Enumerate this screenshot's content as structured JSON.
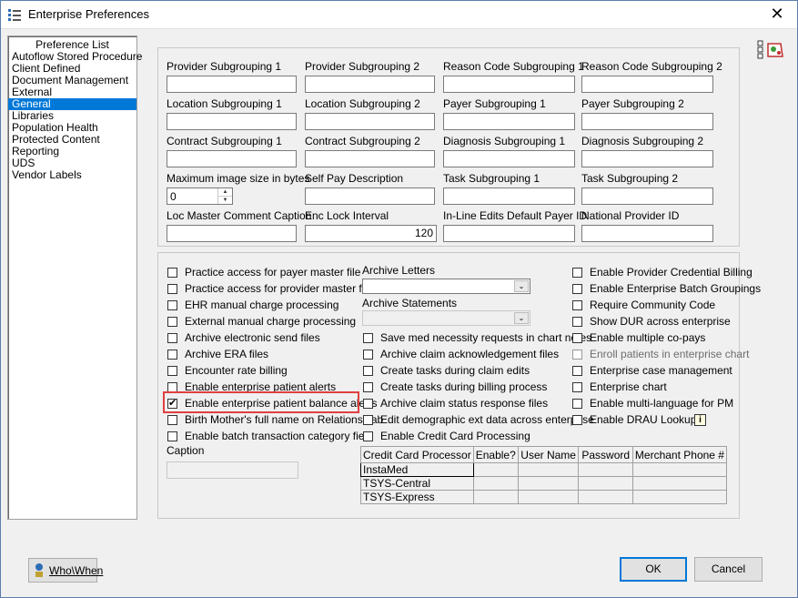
{
  "window": {
    "title": "Enterprise Preferences",
    "close_glyph": "✕"
  },
  "preference_list": {
    "header": "Preference List",
    "items": [
      "Autoflow Stored Procedure",
      "Client Defined",
      "Document Management",
      "External",
      "General",
      "Libraries",
      "Population Health",
      "Protected Content",
      "Reporting",
      "UDS",
      "Vendor Labels"
    ],
    "selected": "General"
  },
  "fields": {
    "provider_subgrouping_1": "Provider Subgrouping 1",
    "provider_subgrouping_2": "Provider Subgrouping 2",
    "reason_code_subgrouping_1": "Reason Code Subgrouping 1",
    "reason_code_subgrouping_2": "Reason Code Subgrouping 2",
    "location_subgrouping_1": "Location Subgrouping 1",
    "location_subgrouping_2": "Location Subgrouping 2",
    "payer_subgrouping_1": "Payer Subgrouping 1",
    "payer_subgrouping_2": "Payer Subgrouping 2",
    "contract_subgrouping_1": "Contract Subgrouping 1",
    "contract_subgrouping_2": "Contract Subgrouping 2",
    "diagnosis_subgrouping_1": "Diagnosis Subgrouping 1",
    "diagnosis_subgrouping_2": "Diagnosis Subgrouping 2",
    "max_image_size": "Maximum image size in bytes",
    "max_image_size_value": "0",
    "self_pay_description": "Self Pay Description",
    "task_subgrouping_1": "Task Subgrouping 1",
    "task_subgrouping_2": "Task Subgrouping 2",
    "loc_master_comment_caption": "Loc Master Comment Caption",
    "enc_lock_interval": "Enc Lock Interval",
    "enc_lock_interval_value": "120",
    "inline_edits_default_payer_id": "In-Line Edits Default Payer ID",
    "national_provider_id": "National Provider ID"
  },
  "checkboxes_col1": [
    {
      "label": "Practice access for payer master file",
      "checked": false
    },
    {
      "label": "Practice access for provider master file",
      "checked": false
    },
    {
      "label": "EHR manual charge processing",
      "checked": false
    },
    {
      "label": "External manual charge processing",
      "checked": false
    },
    {
      "label": "Archive electronic send files",
      "checked": false
    },
    {
      "label": "Archive ERA files",
      "checked": false
    },
    {
      "label": "Encounter rate billing",
      "checked": false
    },
    {
      "label": "Enable enterprise patient alerts",
      "checked": false
    },
    {
      "label": "Enable enterprise patient balance alerts",
      "checked": true
    },
    {
      "label": "Birth Mother's full name on Relations Tab",
      "checked": false
    },
    {
      "label": "Enable batch transaction category field",
      "checked": false
    }
  ],
  "caption_label": "Caption",
  "archive_letters": "Archive Letters",
  "archive_statements": "Archive Statements",
  "checkboxes_col2": [
    {
      "label": "Save med necessity requests in chart notes",
      "checked": false
    },
    {
      "label": "Archive claim acknowledgement files",
      "checked": false
    },
    {
      "label": "Create tasks during claim edits",
      "checked": false
    },
    {
      "label": "Create tasks during billing process",
      "checked": false
    },
    {
      "label": "Archive claim status response files",
      "checked": false
    },
    {
      "label": "Edit demographic ext data across enterprise",
      "checked": false
    },
    {
      "label": "Enable Credit Card Processing",
      "checked": false
    }
  ],
  "checkboxes_col3": [
    {
      "label": "Enable Provider Credential Billing",
      "checked": false,
      "disabled": false
    },
    {
      "label": "Enable Enterprise Batch Groupings",
      "checked": false,
      "disabled": false
    },
    {
      "label": "Require Community Code",
      "checked": false,
      "disabled": false
    },
    {
      "label": "Show DUR across enterprise",
      "checked": false,
      "disabled": false
    },
    {
      "label": "Enable multiple co-pays",
      "checked": false,
      "disabled": false
    },
    {
      "label": "Enroll patients in enterprise chart",
      "checked": false,
      "disabled": true
    },
    {
      "label": "Enterprise case management",
      "checked": false,
      "disabled": false
    },
    {
      "label": "Enterprise chart",
      "checked": false,
      "disabled": false
    },
    {
      "label": "Enable multi-language for PM",
      "checked": false,
      "disabled": false
    },
    {
      "label": "Enable DRAU Lookup",
      "checked": false,
      "disabled": false
    }
  ],
  "info_glyph": "i",
  "cc_grid": {
    "headers": [
      "Credit Card Processor",
      "Enable?",
      "User Name",
      "Password",
      "Merchant Phone #"
    ],
    "rows": [
      "InstaMed",
      "TSYS-Central",
      "TSYS-Express"
    ]
  },
  "buttons": {
    "who_when": "Who\\When",
    "ok": "OK",
    "cancel": "Cancel"
  },
  "colors": {
    "selection": "#0078d7",
    "highlight_border": "#e04040"
  },
  "icons": [
    "app-icon",
    "close-icon",
    "help-icon",
    "info-icon",
    "who-when-icon"
  ]
}
